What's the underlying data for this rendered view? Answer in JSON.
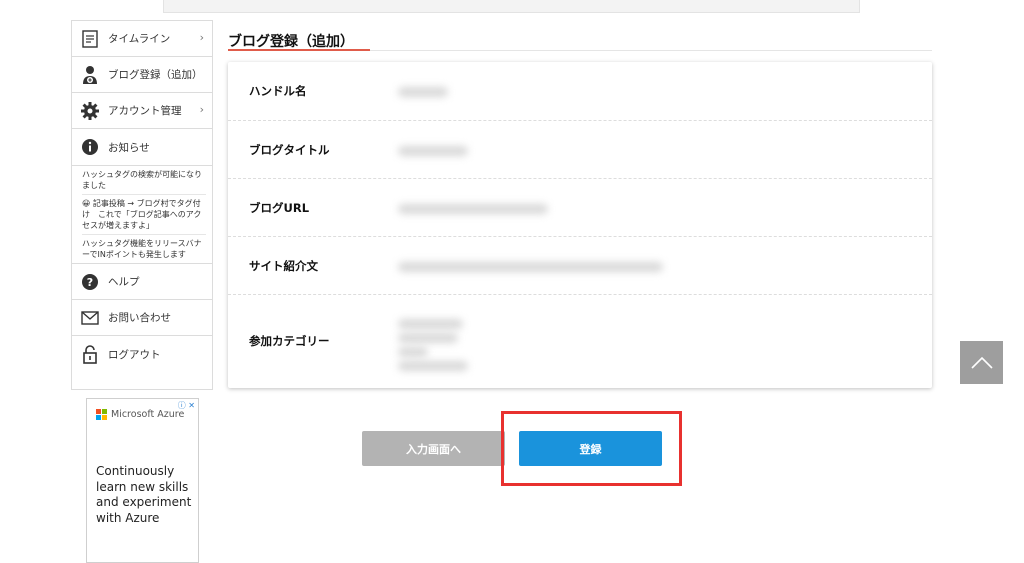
{
  "sidebar": {
    "items": [
      {
        "label": "タイムライン",
        "icon": "timeline-icon",
        "chevron": "›"
      },
      {
        "label": "ブログ登録（追加）",
        "icon": "user-add-icon"
      },
      {
        "label": "アカウント管理",
        "icon": "gear-icon",
        "chevron": "›"
      },
      {
        "label": "お知らせ",
        "icon": "info-icon"
      }
    ],
    "news": [
      "ハッシュタグの検索が可能になりました",
      "😀 記事投稿 → ブログ村でタグ付け　これで「ブログ記事へのアクセスが増えますよ」",
      "ハッシュタグ機能をリリースバナーでINポイントも発生します"
    ],
    "bottom_items": [
      {
        "label": "ヘルプ",
        "icon": "help-icon"
      },
      {
        "label": "お問い合わせ",
        "icon": "mail-icon"
      },
      {
        "label": "ログアウト",
        "icon": "lock-icon"
      }
    ]
  },
  "ad": {
    "brand": "Microsoft Azure",
    "text": "Continuously learn new skills and experiment with Azure",
    "close": "ⓘ ✕"
  },
  "main": {
    "title": "ブログ登録（追加）",
    "fields": [
      {
        "label": "ハンドル名"
      },
      {
        "label": "ブログタイトル"
      },
      {
        "label": "ブログURL"
      },
      {
        "label": "サイト紹介文"
      },
      {
        "label": "参加カテゴリー"
      }
    ]
  },
  "buttons": {
    "back": "入力画面へ",
    "submit": "登録"
  },
  "colors": {
    "accent_red": "#e05c4a",
    "submit_blue": "#1a93dc",
    "back_gray": "#b3b3b3",
    "highlight": "#e8312f"
  }
}
